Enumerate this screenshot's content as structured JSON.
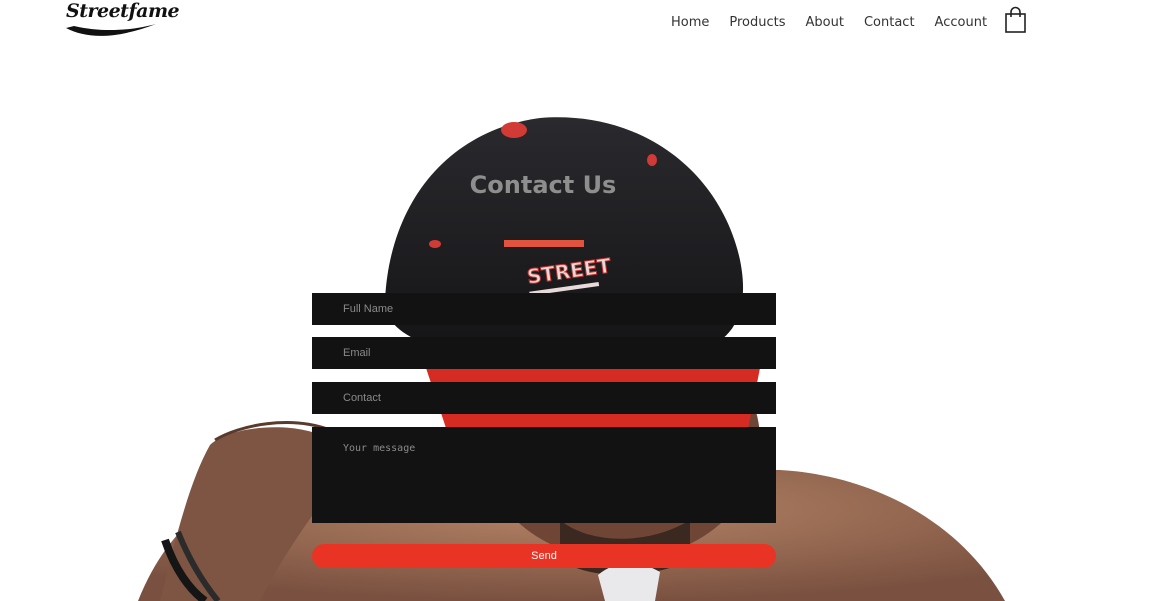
{
  "header": {
    "logo_text": "Streetfame",
    "nav": [
      "Home",
      "Products",
      "About",
      "Contact",
      "Account"
    ]
  },
  "hero": {
    "cap_text": "STREET"
  },
  "contact": {
    "title": "Contact Us",
    "fields": {
      "full_name_placeholder": "Full Name",
      "email_placeholder": "Email",
      "contact_placeholder": "Contact",
      "message_placeholder": "Your message"
    },
    "send_label": "Send"
  },
  "colors": {
    "accent": "#e93325",
    "underline": "#e2533d",
    "field_bg": "#121212",
    "title": "#8e8e8e"
  }
}
